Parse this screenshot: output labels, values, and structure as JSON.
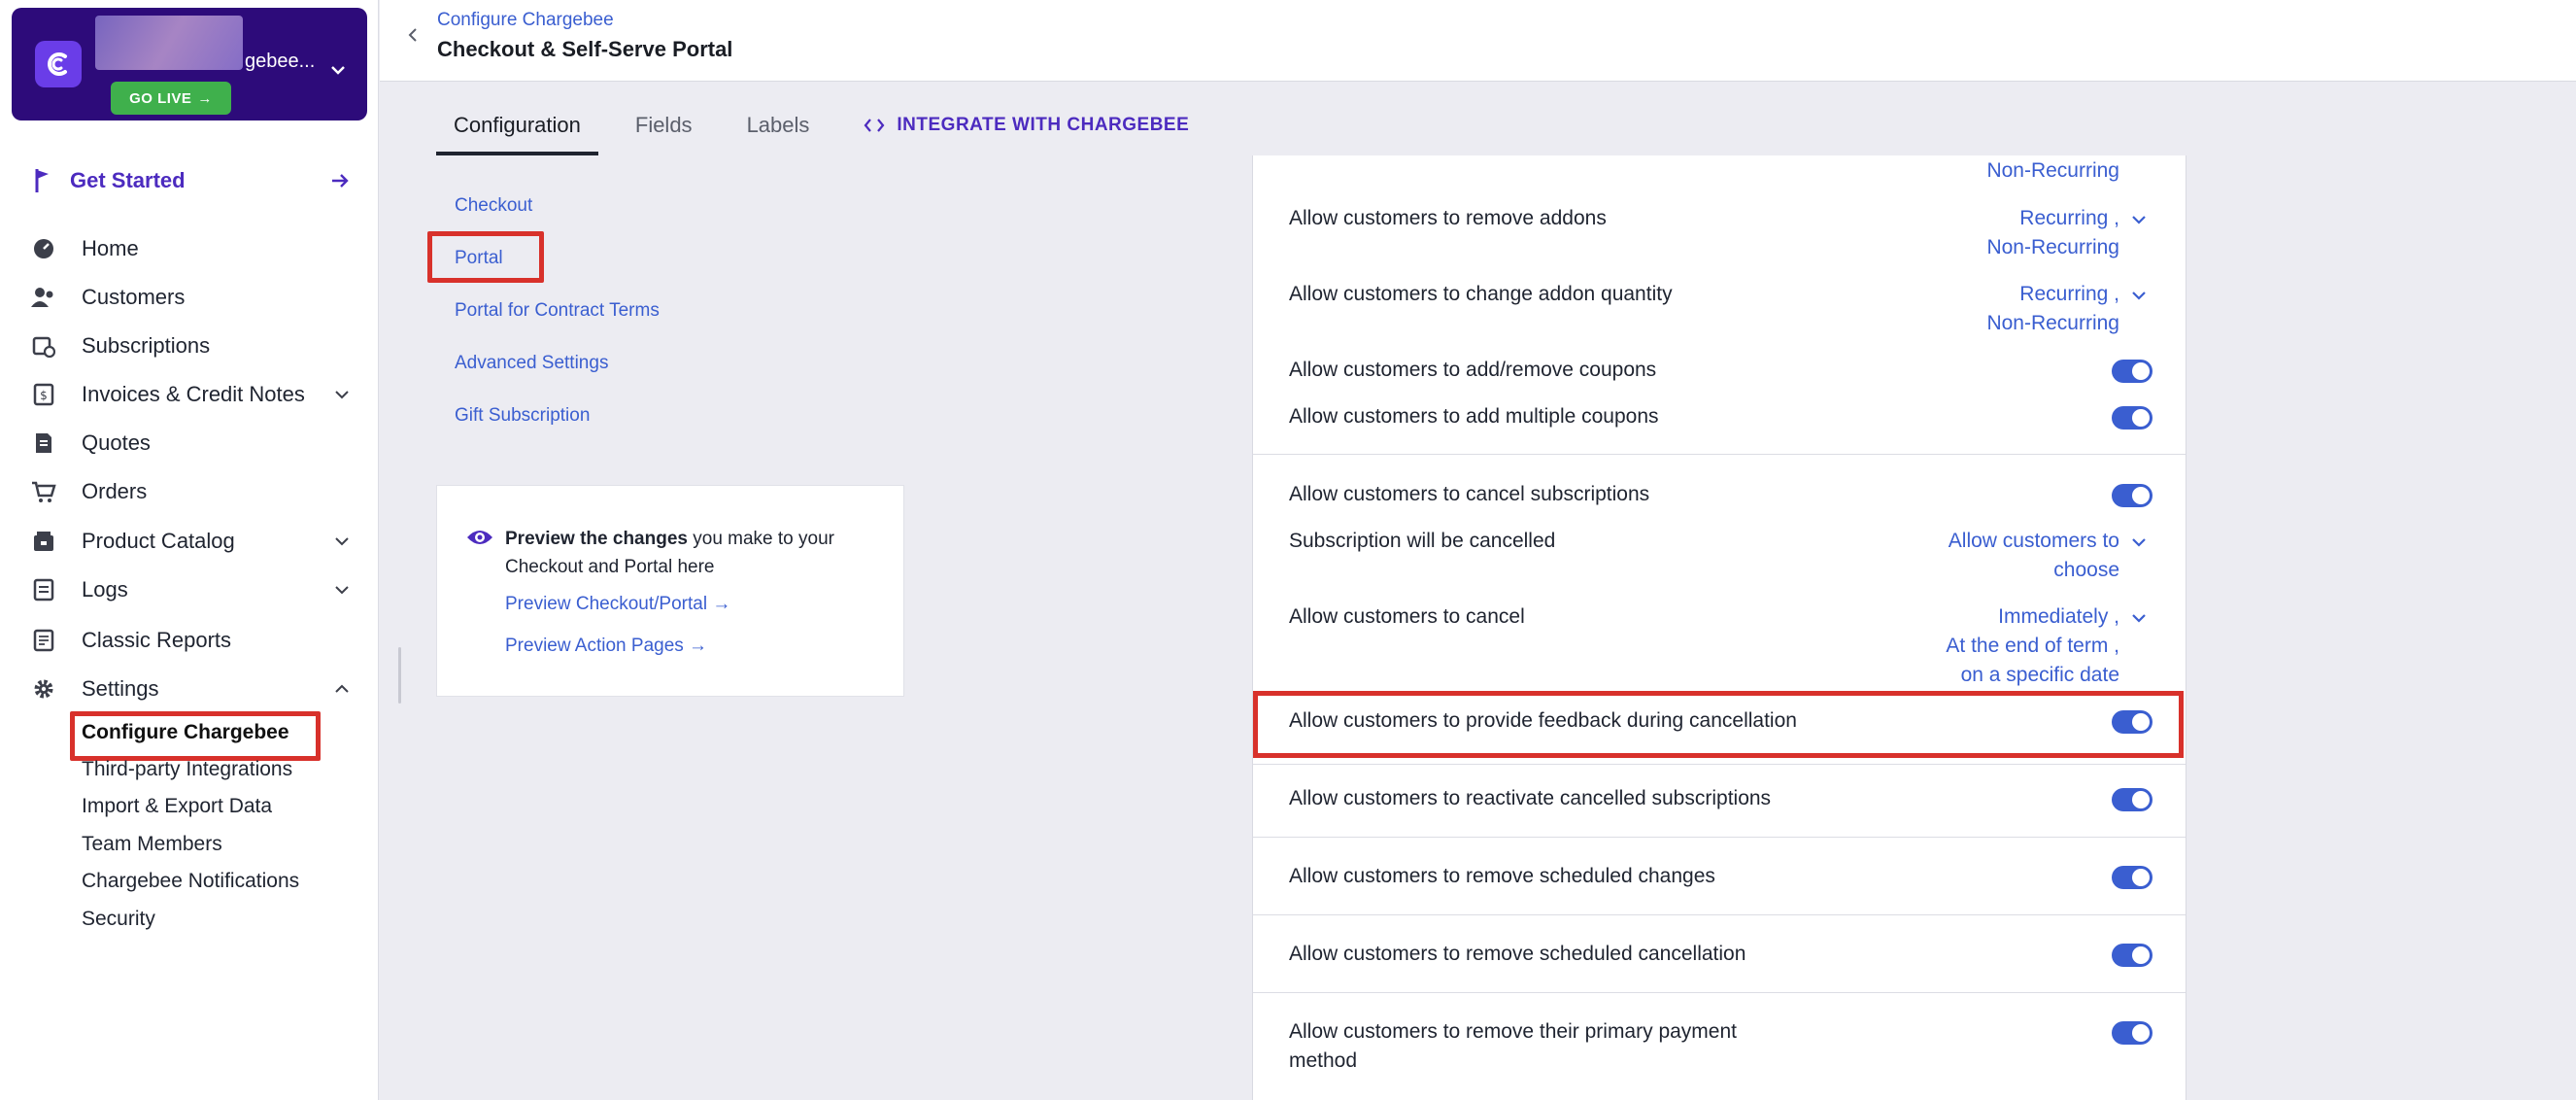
{
  "sidebar": {
    "org": {
      "name_suffix": "gebee...",
      "go_live_label": "GO LIVE"
    },
    "get_started": "Get Started",
    "items": [
      {
        "label": "Home",
        "icon": "dashboard-icon"
      },
      {
        "label": "Customers",
        "icon": "customers-icon"
      },
      {
        "label": "Subscriptions",
        "icon": "subscriptions-icon"
      },
      {
        "label": "Invoices & Credit Notes",
        "icon": "invoice-icon",
        "expandable": true
      },
      {
        "label": "Quotes",
        "icon": "quotes-icon"
      },
      {
        "label": "Orders",
        "icon": "cart-icon"
      },
      {
        "label": "Product Catalog",
        "icon": "catalog-icon",
        "expandable": true
      },
      {
        "label": "Logs",
        "icon": "logs-icon",
        "expandable": true
      },
      {
        "label": "Classic Reports",
        "icon": "reports-icon"
      },
      {
        "label": "Settings",
        "icon": "gear-icon",
        "expanded": true
      }
    ],
    "settings_sub": [
      "Configure Chargebee",
      "Third-party Integrations",
      "Import & Export Data",
      "Team Members",
      "Chargebee Notifications",
      "Security"
    ]
  },
  "header": {
    "breadcrumb": "Configure Chargebee",
    "title": "Checkout & Self-Serve Portal"
  },
  "tabs": [
    "Configuration",
    "Fields",
    "Labels"
  ],
  "integrate_tab": "INTEGRATE WITH CHARGEBEE",
  "sections": [
    "Checkout",
    "Portal",
    "Portal for Contract Terms",
    "Advanced Settings",
    "Gift Subscription"
  ],
  "preview": {
    "bold": "Preview the changes",
    "rest": " you make to your Checkout and Portal here",
    "link_checkout": "Preview Checkout/Portal →",
    "link_action": "Preview Action Pages →"
  },
  "settings": {
    "top_value": "Non-Recurring",
    "remove_addons": {
      "label": "Allow customers to remove addons",
      "v1": "Recurring ,",
      "v2": "Non-Recurring"
    },
    "change_addon_qty": {
      "label": "Allow customers to change addon quantity",
      "v1": "Recurring ,",
      "v2": "Non-Recurring"
    },
    "add_remove_coupons": "Allow customers to add/remove coupons",
    "add_multiple_coupons": "Allow customers to add multiple coupons",
    "cancel_subscriptions": "Allow customers to cancel subscriptions",
    "will_be_cancelled": {
      "label": "Subscription will be cancelled",
      "v1": "Allow customers to",
      "v2": "choose"
    },
    "allow_cancel": {
      "label": "Allow customers to cancel",
      "v1": "Immediately ,",
      "v2": "At the end of term ,",
      "v3": "on a specific date"
    },
    "feedback": "Allow customers to provide feedback during cancellation",
    "reactivate": "Allow customers to reactivate cancelled subscriptions",
    "remove_scheduled_changes": "Allow customers to remove scheduled changes",
    "remove_scheduled_cancellation": "Allow customers to remove scheduled cancellation",
    "remove_payment": {
      "l1": "Allow customers to remove their primary payment",
      "l2": "method"
    }
  },
  "colors": {
    "accent": "#3a5ed0",
    "brand": "#4c2bbf",
    "highlight": "#d8312b",
    "go_live": "#3fb04c"
  }
}
